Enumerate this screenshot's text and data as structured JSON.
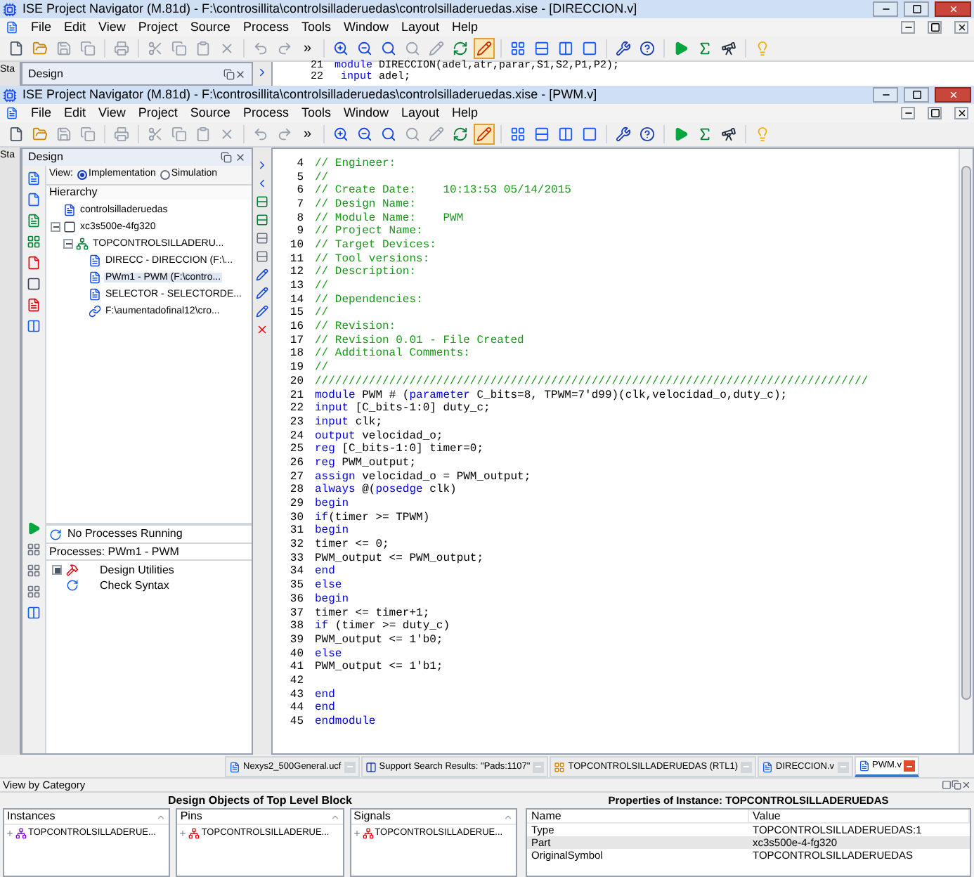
{
  "back_window": {
    "title": "ISE Project Navigator (M.81d) - F:\\controsillita\\controlsilladeruedas\\controlsilladeruedas.xise - [DIRECCION.v]",
    "menu": [
      "File",
      "Edit",
      "View",
      "Project",
      "Source",
      "Process",
      "Tools",
      "Window",
      "Layout",
      "Help"
    ],
    "toolbar": {
      "overflow": "»",
      "select_tool_active": true
    },
    "left_tab": "Sta",
    "panel_title": "Design",
    "code": [
      {
        "no": "21",
        "tokens": [
          {
            "text": "module",
            "kind": "keyword"
          },
          {
            "text": " DIRECCION(adel,atr,parar,S1,S2,P1,P2);",
            "kind": "plain"
          }
        ]
      },
      {
        "no": "22",
        "tokens": [
          {
            "text": " input",
            "kind": "keyword"
          },
          {
            "text": " adel;",
            "kind": "plain"
          }
        ]
      }
    ]
  },
  "window": {
    "title": "ISE Project Navigator (M.81d) - F:\\controsillita\\controlsilladeruedas\\controlsilladeruedas.xise - [PWM.v]",
    "menu": [
      "File",
      "Edit",
      "View",
      "Project",
      "Source",
      "Process",
      "Tools",
      "Window",
      "Layout",
      "Help"
    ],
    "toolbar": {
      "overflow": "»",
      "select_tool_active": true
    },
    "left_tab": "Sta",
    "design": {
      "title": "Design",
      "view_label": "View:",
      "views": [
        {
          "label": "Implementation",
          "selected": true
        },
        {
          "label": "Simulation",
          "selected": false
        }
      ],
      "hierarchy_title": "Hierarchy",
      "tree": [
        {
          "label": "controlsilladeruedas",
          "kind": "project",
          "selected": false
        },
        {
          "label": "xc3s500e-4fg320",
          "kind": "device",
          "selected": false,
          "expanded": true,
          "children": [
            {
              "label": "TOPCONTROLSILLADERU...",
              "kind": "top",
              "selected": false,
              "expanded": true,
              "children": [
                {
                  "label": "DIRECC - DIRECCION (F:\\...",
                  "kind": "file",
                  "selected": false
                },
                {
                  "label": "PWm1 - PWM (F:\\contro...",
                  "kind": "file",
                  "selected": true
                },
                {
                  "label": "SELECTOR - SELECTORDE...",
                  "kind": "file",
                  "selected": false
                },
                {
                  "label": "F:\\aumentadofinal12\\cro...",
                  "kind": "link",
                  "selected": false
                }
              ]
            }
          ]
        }
      ],
      "process_status": "No Processes Running",
      "processes_title": "Processes: PWm1 - PWM",
      "processes": [
        {
          "label": "Design Utilities",
          "kind": "utilities",
          "expanded": false
        },
        {
          "label": "Check Syntax",
          "kind": "syntax"
        }
      ]
    },
    "code": [
      {
        "no": "4",
        "tokens": [
          {
            "text": "// Engineer:",
            "kind": "comment"
          }
        ]
      },
      {
        "no": "5",
        "tokens": [
          {
            "text": "//",
            "kind": "comment"
          }
        ]
      },
      {
        "no": "6",
        "tokens": [
          {
            "text": "// Create Date:    10:13:53 05/14/2015",
            "kind": "comment"
          }
        ]
      },
      {
        "no": "7",
        "tokens": [
          {
            "text": "// Design Name:",
            "kind": "comment"
          }
        ]
      },
      {
        "no": "8",
        "tokens": [
          {
            "text": "// Module Name:    PWM",
            "kind": "comment"
          }
        ]
      },
      {
        "no": "9",
        "tokens": [
          {
            "text": "// Project Name:",
            "kind": "comment"
          }
        ]
      },
      {
        "no": "10",
        "tokens": [
          {
            "text": "// Target Devices:",
            "kind": "comment"
          }
        ]
      },
      {
        "no": "11",
        "tokens": [
          {
            "text": "// Tool versions:",
            "kind": "comment"
          }
        ]
      },
      {
        "no": "12",
        "tokens": [
          {
            "text": "// Description:",
            "kind": "comment"
          }
        ]
      },
      {
        "no": "13",
        "tokens": [
          {
            "text": "//",
            "kind": "comment"
          }
        ]
      },
      {
        "no": "14",
        "tokens": [
          {
            "text": "// Dependencies:",
            "kind": "comment"
          }
        ]
      },
      {
        "no": "15",
        "tokens": [
          {
            "text": "//",
            "kind": "comment"
          }
        ]
      },
      {
        "no": "16",
        "tokens": [
          {
            "text": "// Revision:",
            "kind": "comment"
          }
        ]
      },
      {
        "no": "17",
        "tokens": [
          {
            "text": "// Revision 0.01 - File Created",
            "kind": "comment"
          }
        ]
      },
      {
        "no": "18",
        "tokens": [
          {
            "text": "// Additional Comments:",
            "kind": "comment"
          }
        ]
      },
      {
        "no": "19",
        "tokens": [
          {
            "text": "//",
            "kind": "comment"
          }
        ]
      },
      {
        "no": "20",
        "tokens": [
          {
            "text": "//////////////////////////////////////////////////////////////////////////////////",
            "kind": "comment"
          }
        ]
      },
      {
        "no": "21",
        "tokens": [
          {
            "text": "module",
            "kind": "keyword"
          },
          {
            "text": " PWM # (",
            "kind": "plain"
          },
          {
            "text": "parameter",
            "kind": "keyword"
          },
          {
            "text": " C_bits=8, TPWM=7'd99)(clk,velocidad_o,duty_c);",
            "kind": "plain"
          }
        ]
      },
      {
        "no": "22",
        "tokens": [
          {
            "text": "input",
            "kind": "keyword"
          },
          {
            "text": " [C_bits-1:0] duty_c;",
            "kind": "plain"
          }
        ]
      },
      {
        "no": "23",
        "tokens": [
          {
            "text": "input",
            "kind": "keyword"
          },
          {
            "text": " clk;",
            "kind": "plain"
          }
        ]
      },
      {
        "no": "24",
        "tokens": [
          {
            "text": "output",
            "kind": "keyword"
          },
          {
            "text": " velocidad_o;",
            "kind": "plain"
          }
        ]
      },
      {
        "no": "25",
        "tokens": [
          {
            "text": "reg",
            "kind": "keyword"
          },
          {
            "text": " [C_bits-1:0] timer=0;",
            "kind": "plain"
          }
        ]
      },
      {
        "no": "26",
        "tokens": [
          {
            "text": "reg",
            "kind": "keyword"
          },
          {
            "text": " PWM_output;",
            "kind": "plain"
          }
        ]
      },
      {
        "no": "27",
        "tokens": [
          {
            "text": "assign",
            "kind": "keyword"
          },
          {
            "text": " velocidad_o = PWM_output;",
            "kind": "plain"
          }
        ]
      },
      {
        "no": "28",
        "tokens": [
          {
            "text": "always",
            "kind": "keyword"
          },
          {
            "text": " @(",
            "kind": "plain"
          },
          {
            "text": "posedge",
            "kind": "keyword"
          },
          {
            "text": " clk)",
            "kind": "plain"
          }
        ]
      },
      {
        "no": "29",
        "tokens": [
          {
            "text": "begin",
            "kind": "keyword"
          }
        ]
      },
      {
        "no": "30",
        "tokens": [
          {
            "text": "if",
            "kind": "keyword"
          },
          {
            "text": "(timer >= TPWM)",
            "kind": "plain"
          }
        ]
      },
      {
        "no": "31",
        "tokens": [
          {
            "text": "begin",
            "kind": "keyword"
          }
        ]
      },
      {
        "no": "32",
        "tokens": [
          {
            "text": "timer <= 0;",
            "kind": "plain"
          }
        ]
      },
      {
        "no": "33",
        "tokens": [
          {
            "text": "PWM_output <= PWM_output;",
            "kind": "plain"
          }
        ]
      },
      {
        "no": "34",
        "tokens": [
          {
            "text": "end",
            "kind": "keyword"
          }
        ]
      },
      {
        "no": "35",
        "tokens": [
          {
            "text": "else",
            "kind": "keyword"
          }
        ]
      },
      {
        "no": "36",
        "tokens": [
          {
            "text": "begin",
            "kind": "keyword"
          }
        ]
      },
      {
        "no": "37",
        "tokens": [
          {
            "text": "timer <= timer+1;",
            "kind": "plain"
          }
        ]
      },
      {
        "no": "38",
        "tokens": [
          {
            "text": "if",
            "kind": "keyword"
          },
          {
            "text": " (timer >= duty_c)",
            "kind": "plain"
          }
        ]
      },
      {
        "no": "39",
        "tokens": [
          {
            "text": "PWM_output <= 1'b0;",
            "kind": "plain"
          }
        ]
      },
      {
        "no": "40",
        "tokens": [
          {
            "text": "else",
            "kind": "keyword"
          }
        ]
      },
      {
        "no": "41",
        "tokens": [
          {
            "text": "PWM_output <= 1'b1;",
            "kind": "plain"
          }
        ]
      },
      {
        "no": "42"
      },
      {
        "no": "43",
        "tokens": [
          {
            "text": "end",
            "kind": "keyword"
          }
        ]
      },
      {
        "no": "44",
        "tokens": [
          {
            "text": "end",
            "kind": "keyword"
          }
        ]
      },
      {
        "no": "45",
        "tokens": [
          {
            "text": "endmodule",
            "kind": "keyword"
          }
        ]
      }
    ],
    "editor_tabs": [
      {
        "label": "Nexys2_500General.ucf",
        "kind": "file",
        "selected": false
      },
      {
        "label": "Support Search Results: \"Pads:1107\"",
        "kind": "web",
        "selected": false
      },
      {
        "label": "TOPCONTROLSILLADERUEDAS (RTL1)",
        "kind": "schematic",
        "selected": false
      },
      {
        "label": "DIRECCION.v",
        "kind": "file",
        "selected": false
      },
      {
        "label": "PWM.v",
        "kind": "file",
        "selected": true
      }
    ]
  },
  "bottom_panel": {
    "title": "View by Category",
    "objects_title": "Design Objects of Top Level Block",
    "lists": [
      {
        "heading": "Instances",
        "items": [
          {
            "label": "TOPCONTROLSILLADERUE...",
            "kind": "instance"
          }
        ]
      },
      {
        "heading": "Pins",
        "items": [
          {
            "label": "TOPCONTROLSILLADERUE...",
            "kind": "pin"
          }
        ]
      },
      {
        "heading": "Signals",
        "items": [
          {
            "label": "TOPCONTROLSILLADERUE...",
            "kind": "pin"
          }
        ]
      }
    ],
    "properties_title": "Properties of Instance: TOPCONTROLSILLADERUEDAS",
    "columns": [
      "Name",
      "Value"
    ],
    "rows": [
      {
        "name": "Type",
        "value": "TOPCONTROLSILLADERUEDAS:1",
        "selected": false
      },
      {
        "name": "Part",
        "value": "xc3s500e-4-fg320",
        "selected": true
      },
      {
        "name": "OriginalSymbol",
        "value": "TOPCONTROLSILLADERUEDAS",
        "selected": false
      }
    ]
  }
}
